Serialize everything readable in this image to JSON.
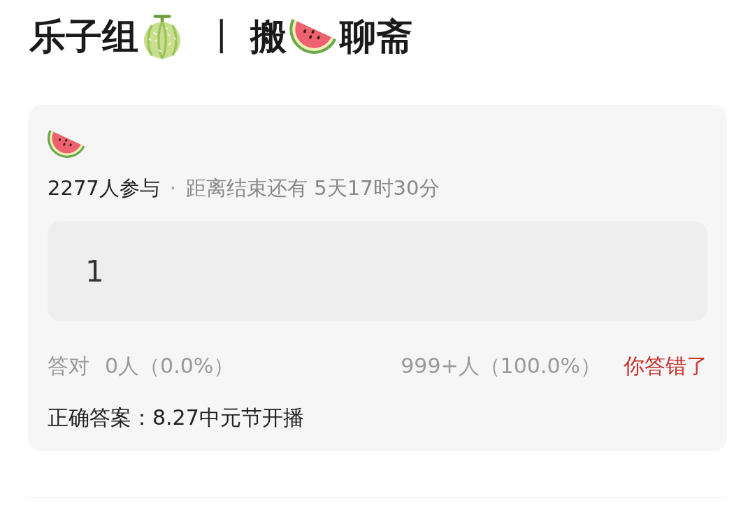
{
  "header": {
    "group": "乐子组",
    "separator": "丨",
    "topic_start": "搬",
    "topic_end": "聊斋"
  },
  "poll": {
    "participants": "2277人参与",
    "dot": "·",
    "countdown": "距离结束还有 5天17时30分",
    "options": [
      {
        "label": "1"
      }
    ],
    "correct_label": "答对",
    "correct_count": "0人（0.0%）",
    "wrong_count": "999+人（100.0%）",
    "result": {
      "text": "你答错了",
      "correct": false
    },
    "answer": "正确答案：8.27中元节开播"
  }
}
